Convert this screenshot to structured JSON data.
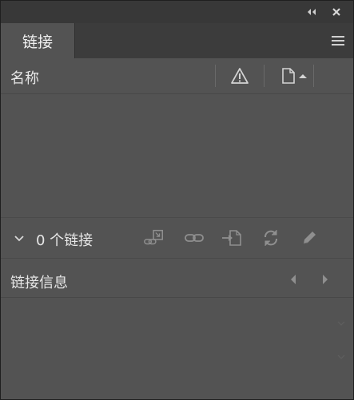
{
  "panel": {
    "tab_label": "链接",
    "columns": {
      "name": "名称"
    },
    "status": {
      "link_count": "0 个链接"
    },
    "info": {
      "label": "链接信息"
    }
  },
  "icons": {
    "collapse": "double-chevron-left-icon",
    "close": "close-icon",
    "menu": "hamburger-menu-icon",
    "warning_column": "warning-triangle-icon",
    "page_column": "page-icon",
    "sort": "sort-up-triangle-icon",
    "toggle": "chevron-down-icon",
    "relink_cc": "relink-from-cc-libraries-icon",
    "relink": "relink-icon",
    "goto_link": "go-to-link-icon",
    "update": "update-link-icon",
    "edit": "edit-original-icon",
    "prev": "previous-link-icon",
    "next": "next-link-icon"
  },
  "colors": {
    "panel_bg": "#535353",
    "title_bg": "#383838",
    "tab_strip_bg": "#3c3c3c",
    "text": "#e6e6e6",
    "icon_light": "#d8d8d8",
    "icon_dim": "#8f8f8f"
  }
}
